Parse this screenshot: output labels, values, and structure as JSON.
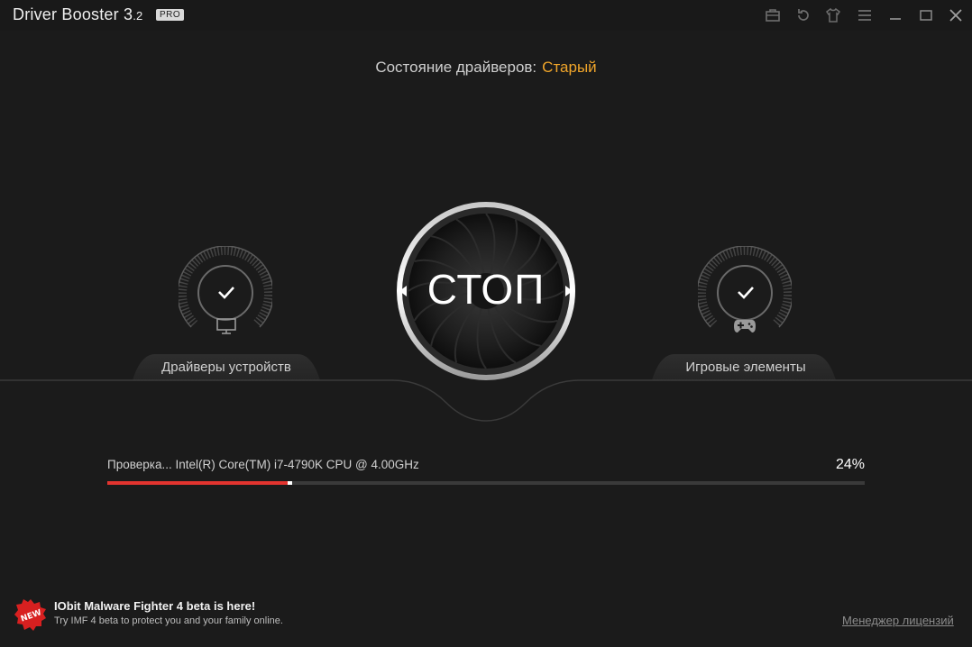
{
  "window": {
    "title": "Driver Booster 3",
    "version": ".2",
    "badge": "PRO",
    "toolbar_icons": [
      "toolbox-icon",
      "restore-icon",
      "skin-icon",
      "menu-icon",
      "minimize-icon",
      "maximize-icon",
      "close-icon"
    ]
  },
  "status": {
    "label": "Состояние драйверов:",
    "value": "Старый",
    "value_color": "#f0a52a"
  },
  "gauges": [
    {
      "label": "Драйверы устройств",
      "icon": "monitor-icon",
      "state": "check-icon"
    },
    {
      "label": "Игровые элементы",
      "icon": "gamepad-icon",
      "state": "check-icon"
    }
  ],
  "stop_button": {
    "label": "СТОП"
  },
  "scan": {
    "text": "Проверка... Intel(R) Core(TM) i7-4790K CPU @ 4.00GHz",
    "percent_label": "24%",
    "progress": 0.24,
    "bar_color": "#e3342f"
  },
  "promo": {
    "badge": "NEW",
    "title": "IObit Malware Fighter 4 beta is here!",
    "subtitle": "Try IMF 4 beta to protect you and your family online."
  },
  "footer": {
    "license_link": "Менеджер лицензий"
  }
}
